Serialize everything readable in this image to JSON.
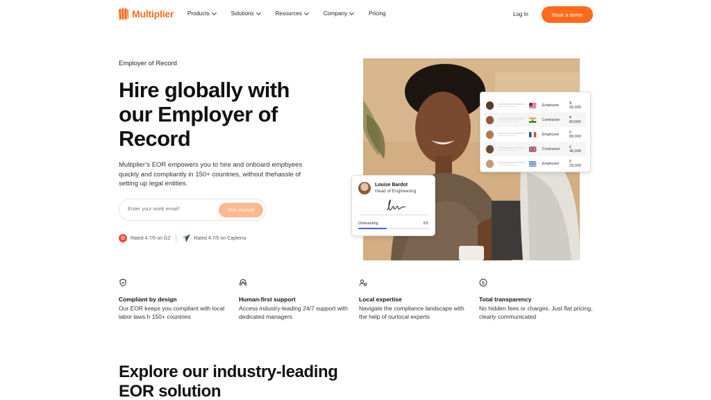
{
  "nav": {
    "brand": "Multiplier",
    "links": [
      {
        "label": "Products",
        "has_menu": true
      },
      {
        "label": "Solutions",
        "has_menu": true
      },
      {
        "label": "Resources",
        "has_menu": true
      },
      {
        "label": "Company",
        "has_menu": true
      },
      {
        "label": "Pricing",
        "has_menu": false
      }
    ],
    "login": "Log in",
    "cta": "Book a demo",
    "accent_color": "#ff6a1a"
  },
  "hero": {
    "eyebrow": "Employer of Record",
    "title": "Hire globally with our Employer of Record",
    "description": "Multiplier’s EOR empowers you to hire and onboard empbyees quickly and compliantly in 150+ countries, without thehassle of setting up legal entities.",
    "email_placeholder": "Enter your work email*",
    "get_started": "Get started",
    "rating_g2": "Rated 4.7/5 on G2",
    "rating_capterra": "Rated 4.7/5 on Capterra"
  },
  "employee_card": {
    "rows": [
      {
        "flag": "us-flag",
        "type": "Employee",
        "salary": "$ 92,000"
      },
      {
        "flag": "india-flag",
        "type": "Contractor",
        "salary": "₹ 80,000"
      },
      {
        "flag": "france-flag",
        "type": "Employee",
        "salary": "€ 89,000"
      },
      {
        "flag": "uk-flag",
        "type": "Contractor",
        "salary": "£ 46,000"
      },
      {
        "flag": "greece-flag",
        "type": "Employee",
        "salary": "€ 29,000"
      }
    ]
  },
  "onboarding_card": {
    "name": "Louise Bardot",
    "role": "Head of Engineering",
    "progress_label": "Onboarding",
    "progress_count": "2/5",
    "progress_fraction": 0.4
  },
  "features": [
    {
      "icon": "shield-icon",
      "title": "Compliant by design",
      "desc": "Our EOR keeps you compliant with local labor laws h 150+ countries"
    },
    {
      "icon": "support-icon",
      "title": "Human-first support",
      "desc": "Access industry-leading 24/7 support with dedicated managers"
    },
    {
      "icon": "local-expertise-icon",
      "title": "Local expertise",
      "desc": "Navigate the compliance landscape with the help of ourlocal experts"
    },
    {
      "icon": "dollar-icon",
      "title": "Total transparency",
      "desc": "No hidden fees or charges. Just flat pricing, clearly communicated"
    }
  ],
  "explore": {
    "title": "Explore our industry-leading EOR solution"
  }
}
